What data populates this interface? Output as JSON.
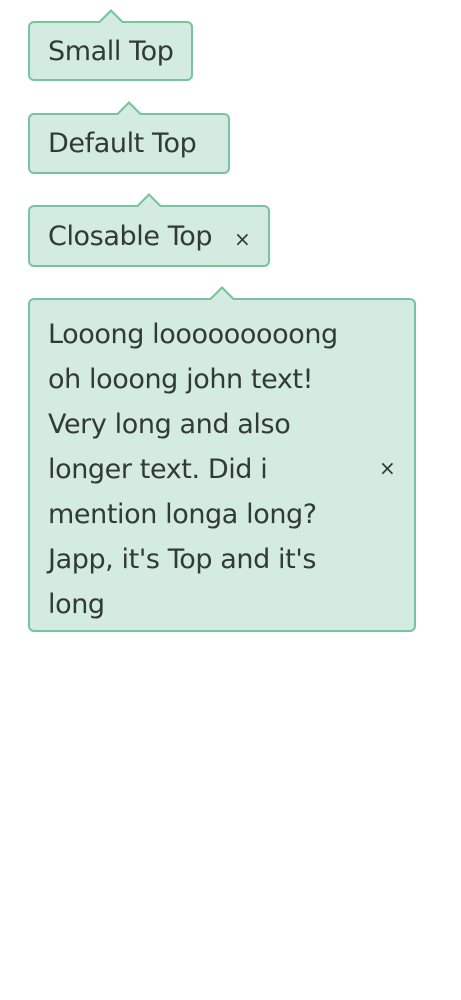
{
  "tooltips": [
    {
      "text": "Small Top"
    },
    {
      "text": "Default Top"
    },
    {
      "text": "Closable Top",
      "close_glyph": "×",
      "close_icon": "close-icon"
    },
    {
      "text": "Looong looooooooong oh looong john text! Very long and also longer text. Did i mention longa long? Japp, it's Top and it's long",
      "close_glyph": "×",
      "close_icon": "close-icon"
    }
  ],
  "colors": {
    "background": "#d3ebe0",
    "border": "#79c4a0",
    "text": "#333a36"
  }
}
